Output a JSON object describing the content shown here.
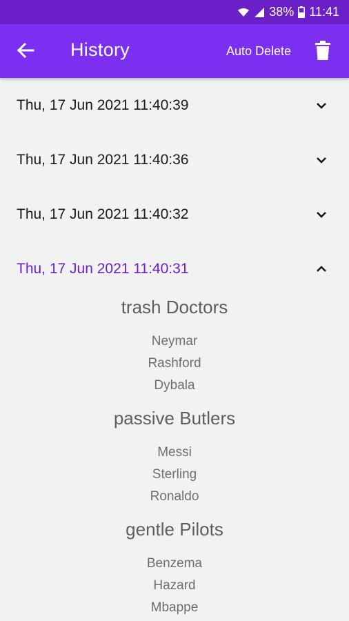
{
  "status_bar": {
    "battery": "38%",
    "time": "11:41"
  },
  "app_bar": {
    "title": "History",
    "auto_delete_label": "Auto Delete"
  },
  "history": [
    {
      "date": "Thu, 17 Jun 2021 11:40:39",
      "expanded": false
    },
    {
      "date": "Thu, 17 Jun 2021 11:40:36",
      "expanded": false
    },
    {
      "date": "Thu, 17 Jun 2021 11:40:32",
      "expanded": false
    },
    {
      "date": "Thu, 17 Jun 2021 11:40:31",
      "expanded": true
    }
  ],
  "teams": [
    {
      "name": "trash Doctors",
      "players": [
        "Neymar",
        "Rashford",
        "Dybala"
      ]
    },
    {
      "name": "passive Butlers",
      "players": [
        "Messi",
        "Sterling",
        "Ronaldo"
      ]
    },
    {
      "name": "gentle Pilots",
      "players": [
        "Benzema",
        "Hazard",
        "Mbappe"
      ]
    }
  ],
  "colors": {
    "status_bar": "#6a1fc9",
    "app_bar": "#7b2ff0",
    "accent_text": "#6a1fd6",
    "background": "#f2f2f2"
  },
  "icons": {
    "back": "arrow-left-icon",
    "delete": "trash-icon",
    "collapsed": "chevron-down-icon",
    "expanded": "chevron-up-icon"
  }
}
